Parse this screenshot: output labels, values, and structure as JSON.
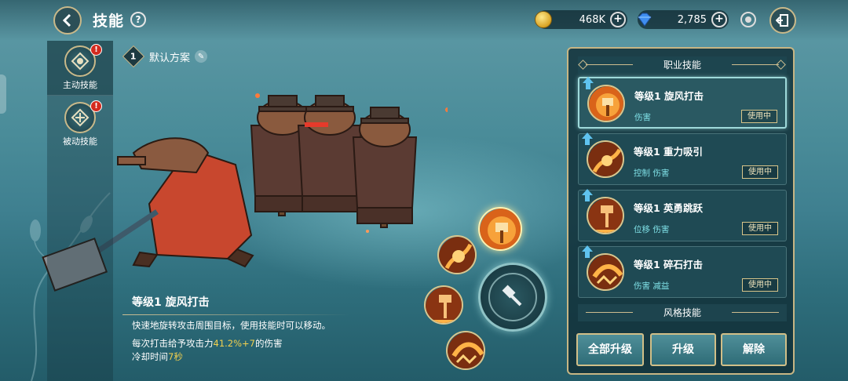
{
  "header": {
    "title": "技能",
    "help_label": "?",
    "gold": "468K",
    "gems": "2,785"
  },
  "side_tabs": [
    {
      "label": "主动技能",
      "badge": "!",
      "active": true
    },
    {
      "label": "被动技能",
      "badge": "!",
      "active": false
    }
  ],
  "preset": {
    "number": "1",
    "label": "默认方案"
  },
  "description": {
    "title": "等级1 旋风打击",
    "summary": "快速地旋转攻击周围目标，使用技能时可以移动。",
    "damage_prefix": "每次打击给予攻击力",
    "damage_value": "41.2%+7",
    "damage_suffix": "的伤害",
    "cooldown_prefix": "冷却时间",
    "cooldown_value": "7秒"
  },
  "panel": {
    "class_skills_header": "职业技能",
    "style_skills_header": "风格技能",
    "skills": [
      {
        "name": "等级1 旋风打击",
        "tags": "伤害",
        "status": "使用中",
        "icon": "whirlwind-skill-icon",
        "active": true
      },
      {
        "name": "等级1 重力吸引",
        "tags": "控制 伤害",
        "status": "使用中",
        "icon": "gravity-skill-icon",
        "active": false
      },
      {
        "name": "等级1 英勇跳跃",
        "tags": "位移 伤害",
        "status": "使用中",
        "icon": "leap-skill-icon",
        "active": false
      },
      {
        "name": "等级1 碎石打击",
        "tags": "伤害 减益",
        "status": "使用中",
        "icon": "rock-smash-skill-icon",
        "active": false
      }
    ],
    "buttons": {
      "upgrade_all": "全部升级",
      "upgrade": "升级",
      "remove": "解除"
    }
  },
  "colors": {
    "accent_gold": "#d1bf88",
    "tag_cyan": "#7fe0e6",
    "highlight_yellow": "#f2d04f",
    "badge_red": "#d42b1f"
  }
}
